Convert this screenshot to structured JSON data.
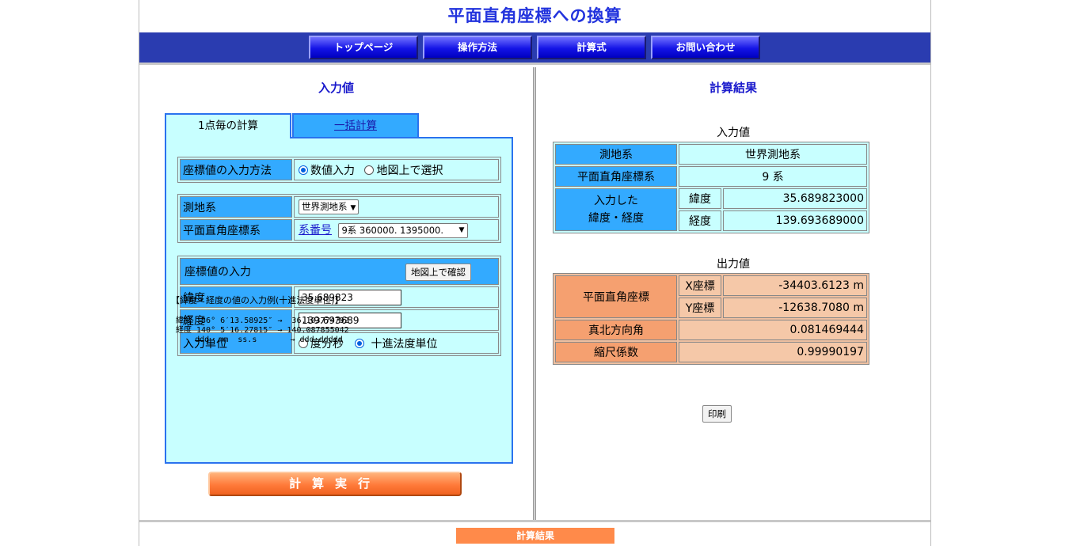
{
  "title": "平面直角座標への換算",
  "nav": {
    "top": "トップページ",
    "howto": "操作方法",
    "formula": "計算式",
    "contact": "お問い合わせ"
  },
  "left": {
    "heading": "入力値",
    "tabs": {
      "single": "1点毎の計算",
      "batch": "一括計算"
    },
    "method": {
      "label": "座標値の入力方法",
      "opt_numeric": "数値入力",
      "opt_map": "地図上で選択",
      "selected": "数値入力"
    },
    "datum": {
      "label": "測地系",
      "value": "世界測地系"
    },
    "plane": {
      "label": "平面直角座標系",
      "link": "系番号",
      "value": "9系 360000. 1395000."
    },
    "coord": {
      "label": "座標値の入力",
      "map_button": "地図上で確認",
      "lat_label": "緯度",
      "lat_value": "35.689823",
      "lon_label": "経度",
      "lon_value": "139.693689",
      "unit_label": "入力単位",
      "unit_dms": "度分秒",
      "unit_dec": "十進法度単位",
      "unit_selected": "十進法度単位"
    },
    "example": {
      "heading": "【緯度・経度の値の入力例(十進法度単位)】",
      "line1": "緯度  36° 6′13.58925″ →  36.103774792",
      "line2": "経度 140° 5′16.27815″ → 140.087855042",
      "line3": "    ddd  mm  ss.s       → ddd.ddddd"
    },
    "calc_button": "計算実行"
  },
  "right": {
    "heading": "計算結果",
    "input_caption": "入力値",
    "input": {
      "datum_label": "測地系",
      "datum_value": "世界測地系",
      "plane_label": "平面直角座標系",
      "plane_value": "9 系",
      "latlon_label": "入力した\n緯度・経度",
      "lat_label": "緯度",
      "lat_value": "35.689823000",
      "lon_label": "経度",
      "lon_value": "139.693689000"
    },
    "output_caption": "出力値",
    "output": {
      "xy_label": "平面直角座標",
      "x_label": "X座標",
      "x_value": "-34403.6123 m",
      "y_label": "Y座標",
      "y_value": "-12638.7080 m",
      "north_label": "真北方向角",
      "north_value": "0.081469444",
      "scale_label": "縮尺係数",
      "scale_value": "0.99990197"
    },
    "print_button": "印刷"
  },
  "footer": {
    "tag": "計算結果"
  }
}
